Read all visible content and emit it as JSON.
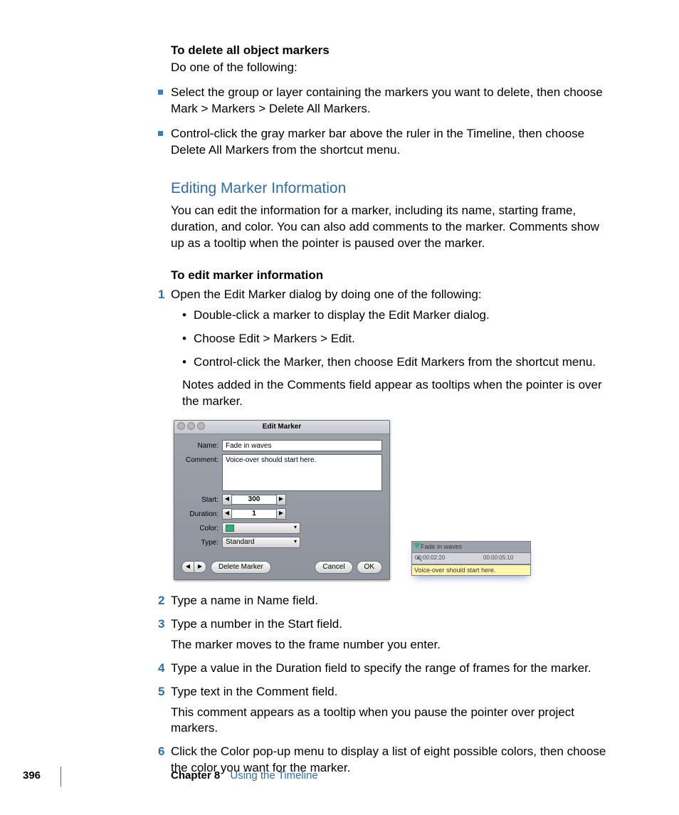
{
  "section1": {
    "title": "To delete all object markers",
    "sub": "Do one of the following:",
    "bullets": [
      "Select the group or layer containing the markers you want to delete, then choose Mark > Markers > Delete All Markers.",
      "Control-click the gray marker bar above the ruler in the Timeline, then choose Delete All Markers from the shortcut menu."
    ]
  },
  "heading": "Editing Marker Information",
  "heading_para": "You can edit the information for a marker, including its name, starting frame, duration, and color. You can also add comments to the marker. Comments show up as a tooltip when the pointer is paused over the marker.",
  "subheading": "To edit marker information",
  "step1": {
    "text": "Open the Edit Marker dialog by doing one of the following:",
    "subs": [
      "Double-click a marker to display the Edit Marker dialog.",
      "Choose Edit > Markers > Edit.",
      "Control-click the Marker, then choose Edit Markers from the shortcut menu."
    ],
    "note": "Notes added in the Comments field appear as tooltips when the pointer is over the marker."
  },
  "dialog": {
    "title": "Edit Marker",
    "labels": {
      "name": "Name:",
      "comment": "Comment:",
      "start": "Start:",
      "duration": "Duration:",
      "color": "Color:",
      "type": "Type:"
    },
    "name_value": "Fade in waves",
    "comment_value": "Voice-over should start here.",
    "start_value": "300",
    "duration_value": "1",
    "type_value": "Standard",
    "btn_delete": "Delete Marker",
    "btn_cancel": "Cancel",
    "btn_ok": "OK"
  },
  "timeline": {
    "marker_label": "Fade in waves",
    "tc1": "00:00:02:20",
    "tc2": "00:00:05:10",
    "tooltip": "Voice-over should start here."
  },
  "step2": "Type a name in Name field.",
  "step3": "Type a number in the Start field.",
  "step3_note": "The marker moves to the frame number you enter.",
  "step4": "Type a value in the Duration field to specify the range of frames for the marker.",
  "step5": "Type text in the Comment field.",
  "step5_note": "This comment appears as a tooltip when you pause the pointer over project markers.",
  "step6": "Click the Color pop-up menu to display a list of eight possible colors, then choose the color you want for the marker.",
  "footer": {
    "page": "396",
    "chapter": "Chapter 8",
    "title": "Using the Timeline"
  }
}
